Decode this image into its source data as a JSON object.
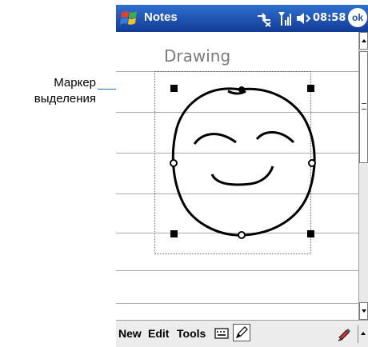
{
  "annotation": {
    "line1": "Маркер",
    "line2": "выделения"
  },
  "titlebar": {
    "app_title": "Notes",
    "clock": "08:58",
    "ok_label": "ok",
    "start_icon": "windows-flag-icon",
    "connectivity_icon": "connectivity-icon",
    "signal_icon": "signal-strength-icon",
    "volume_icon": "speaker-icon"
  },
  "note": {
    "heading": "Drawing"
  },
  "menubar": {
    "new_label": "New",
    "edit_label": "Edit",
    "tools_label": "Tools",
    "keyboard_icon": "keyboard-icon",
    "pen_icon": "pen-icon",
    "recorder_icon": "recorder-icon"
  },
  "colors": {
    "titlebar_top": "#2f6fd0",
    "titlebar_bottom": "#123c96",
    "ruled_line": "#a9a9a9",
    "callout_line": "#1f6fa8",
    "ink": "#000000"
  }
}
